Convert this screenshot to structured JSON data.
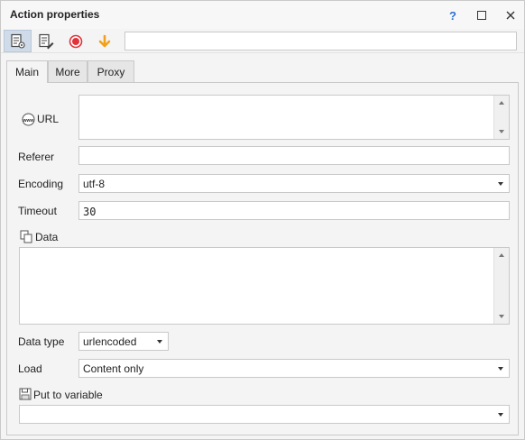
{
  "window": {
    "title": "Action properties",
    "help_icon": "question-icon",
    "maximize_icon": "maximize-icon",
    "close_icon": "close-icon"
  },
  "toolbar": {
    "buttons": [
      "properties-icon",
      "edit-properties-icon",
      "record-icon",
      "download-arrow-icon"
    ],
    "input_value": ""
  },
  "tabs": [
    {
      "label": "Main",
      "active": true
    },
    {
      "label": "More",
      "active": false
    },
    {
      "label": "Proxy",
      "active": false
    }
  ],
  "form": {
    "url": {
      "label": "URL",
      "icon": "www-icon",
      "value": ""
    },
    "referer": {
      "label": "Referer",
      "value": ""
    },
    "encoding": {
      "label": "Encoding",
      "value": "utf-8"
    },
    "timeout": {
      "label": "Timeout",
      "value": "30"
    },
    "data": {
      "label": "Data",
      "icon": "copy-icon",
      "value": ""
    },
    "data_type": {
      "label": "Data type",
      "value": "urlencoded"
    },
    "load": {
      "label": "Load",
      "value": "Content only"
    },
    "put_to_variable": {
      "label": "Put to variable",
      "icon": "save-icon",
      "value": ""
    }
  },
  "colors": {
    "accent": "#2f6fd6",
    "record": "#e0343a",
    "arrow": "#f2a01c",
    "timeout_text": "#8a1f8a"
  }
}
